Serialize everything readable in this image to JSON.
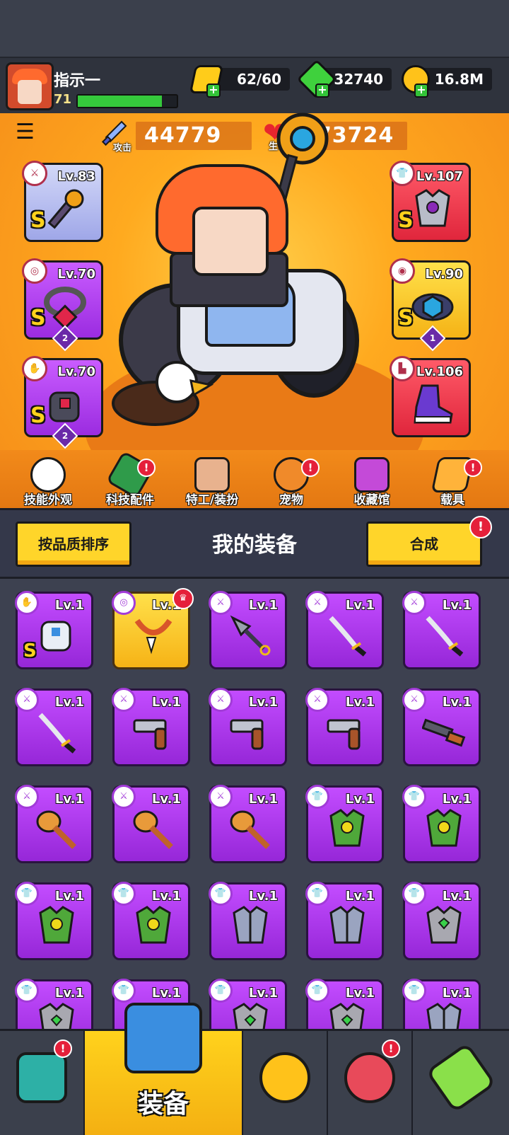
{
  "player": {
    "name": "指示一",
    "level": "71",
    "xp_progress": 0.85
  },
  "resources": {
    "energy": "62/60",
    "gems": "32740",
    "coins": "16.8M"
  },
  "stats": {
    "attack_label": "攻击",
    "attack_value": "44779",
    "hp_label": "生命",
    "hp_value": "173724"
  },
  "equipped": {
    "weapon": {
      "level": "Lv.83",
      "grade": "S"
    },
    "necklace": {
      "level": "Lv.70",
      "grade": "S",
      "stars": "2"
    },
    "gloves": {
      "level": "Lv.70",
      "grade": "S",
      "stars": "2"
    },
    "armor": {
      "level": "Lv.107",
      "grade": "S"
    },
    "belt": {
      "level": "Lv.90",
      "grade": "S",
      "stars": "1"
    },
    "boots": {
      "level": "Lv.106"
    }
  },
  "nav": [
    {
      "label": "技能外观"
    },
    {
      "label": "科技配件"
    },
    {
      "label": "特工/装扮"
    },
    {
      "label": "宠物"
    },
    {
      "label": "收藏馆"
    },
    {
      "label": "载具"
    }
  ],
  "toolbar": {
    "sort_label": "按品质排序",
    "title": "我的装备",
    "merge_label": "合成",
    "alert": "!"
  },
  "items_level": "Lv.1",
  "items": [
    {
      "type": "gloves",
      "grade": "S"
    },
    {
      "type": "necklace"
    },
    {
      "type": "kunai"
    },
    {
      "type": "katana"
    },
    {
      "type": "katana"
    },
    {
      "type": "katana"
    },
    {
      "type": "revolver"
    },
    {
      "type": "revolver"
    },
    {
      "type": "revolver"
    },
    {
      "type": "shotgun"
    },
    {
      "type": "drumstick"
    },
    {
      "type": "drumstick"
    },
    {
      "type": "drumstick"
    },
    {
      "type": "green-armor"
    },
    {
      "type": "green-armor"
    },
    {
      "type": "green-armor"
    },
    {
      "type": "green-armor"
    },
    {
      "type": "steel-armor"
    },
    {
      "type": "steel-armor"
    },
    {
      "type": "gray-armor"
    },
    {
      "type": "gray-armor"
    },
    {
      "type": "gray-armor"
    },
    {
      "type": "gray-armor"
    },
    {
      "type": "gray-armor"
    },
    {
      "type": "steel-armor"
    }
  ],
  "tabs": [
    {
      "label": ""
    },
    {
      "label": "装备"
    },
    {
      "label": ""
    },
    {
      "label": ""
    },
    {
      "label": ""
    }
  ],
  "colors": {
    "accent": "#ffd52a",
    "item_purple": "#b23cf0",
    "alert_red": "#e5203a"
  }
}
